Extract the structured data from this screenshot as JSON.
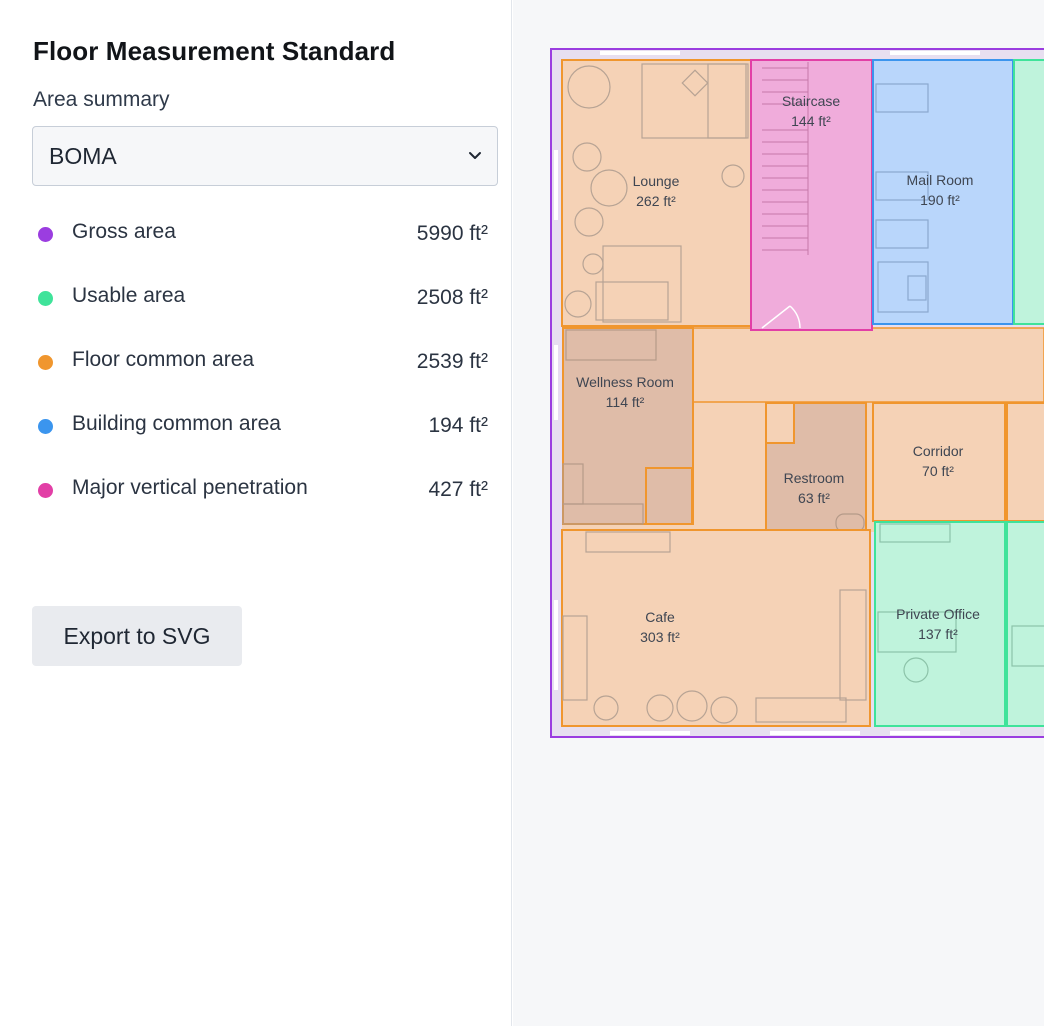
{
  "sidebar": {
    "title": "Floor Measurement Standard",
    "area_summary_label": "Area summary",
    "standard_select": {
      "value": "BOMA",
      "icon": "chevron-down-icon"
    },
    "summary": [
      {
        "label": "Gross area",
        "value": "5990 ft²",
        "color": "#9b3de0"
      },
      {
        "label": "Usable area",
        "value": "2508 ft²",
        "color": "#3fe39a"
      },
      {
        "label": "Floor common area",
        "value": "2539 ft²",
        "color": "#f0962e"
      },
      {
        "label": "Building common area",
        "value": "194 ft²",
        "color": "#3b95ee"
      },
      {
        "label": "Major vertical penetration",
        "value": "427 ft²",
        "color": "#e23fa6"
      }
    ],
    "export_label": "Export to SVG"
  },
  "floorplan": {
    "rooms": {
      "staircase": {
        "name": "Staircase",
        "area": "144 ft²"
      },
      "lounge": {
        "name": "Lounge",
        "area": "262 ft²"
      },
      "mail_room": {
        "name": "Mail Room",
        "area": "190 ft²"
      },
      "wellness_room": {
        "name": "Wellness Room",
        "area": "114 ft²"
      },
      "restroom": {
        "name": "Restroom",
        "area": "63 ft²"
      },
      "corridor": {
        "name": "Corridor",
        "area": "70 ft²"
      },
      "cafe": {
        "name": "Cafe",
        "area": "303 ft²"
      },
      "private_office": {
        "name": "Private Office",
        "area": "137 ft²"
      }
    },
    "colors": {
      "gross": "#9b3de0",
      "usable": "#3fe39a",
      "floor_common": "#f0962e",
      "building_common": "#3b95ee",
      "vertical_penetration": "#e23fa6"
    }
  }
}
